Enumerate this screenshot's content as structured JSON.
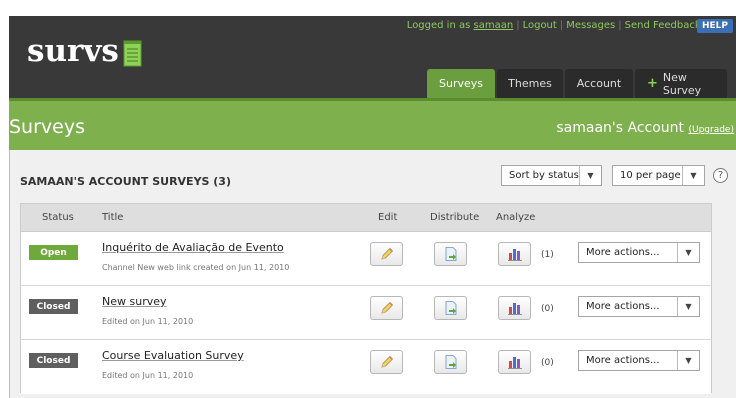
{
  "app": {
    "logo_text": "survs"
  },
  "toplinks": {
    "logged_in_prefix": "Logged in as",
    "username": "samaan",
    "logout": "Logout",
    "messages": "Messages",
    "send_feedback": "Send Feedback",
    "help": "HELP"
  },
  "tabs": [
    {
      "label": "Surveys"
    },
    {
      "label": "Themes"
    },
    {
      "label": "Account"
    },
    {
      "label": "New Survey"
    }
  ],
  "page": {
    "title": "Surveys",
    "account_label": "samaan's Account",
    "upgrade": "(Upgrade)"
  },
  "section": {
    "title": "SAMAAN'S ACCOUNT SURVEYS (3)",
    "sort_value": "Sort by status",
    "per_page_value": "10 per page",
    "help_icon": "?"
  },
  "columns": {
    "status": "Status",
    "title": "Title",
    "edit": "Edit",
    "distribute": "Distribute",
    "analyze": "Analyze"
  },
  "rows": [
    {
      "status": "Open",
      "title": "Inquérito de Avaliação de Evento",
      "subtitle": "Channel New web link created on Jun 11, 2010",
      "count": "(1)",
      "action": "More actions..."
    },
    {
      "status": "Closed",
      "title": "New survey",
      "subtitle": "Edited on Jun 11, 2010",
      "count": "(0)",
      "action": "More actions..."
    },
    {
      "status": "Closed",
      "title": "Course Evaluation Survey",
      "subtitle": "Edited on Jun 11, 2010",
      "count": "(0)",
      "action": "More actions..."
    }
  ],
  "colors": {
    "header_bg": "#393939",
    "brand_green": "#7eb04d",
    "link_green": "#8ec85f",
    "help_blue": "#3a6fb7",
    "open_badge": "#6fa93c",
    "closed_badge": "#5f5f5f"
  },
  "icons": {
    "logo": "notepad-icon",
    "edit": "pencil-icon",
    "distribute": "page-arrow-icon",
    "analyze": "bar-chart-icon",
    "dropdown": "chevron-down-icon",
    "help": "question-circle-icon",
    "new_survey": "plus-icon"
  }
}
